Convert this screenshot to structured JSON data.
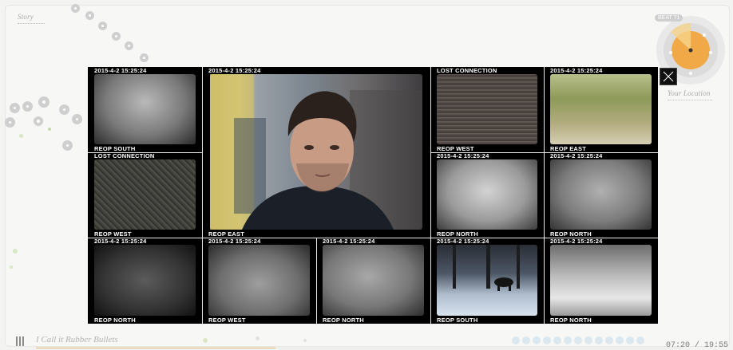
{
  "nav": {
    "story_label": "Story"
  },
  "compass": {
    "speed_badge": "BEAT 71",
    "location_label": "Your Location"
  },
  "modal": {
    "close_label": "close",
    "cells": [
      {
        "id": "c1",
        "timestamp": "2015-4-2 15:25:24",
        "camera": "REOP SOUTH",
        "feed": "night"
      },
      {
        "id": "c2",
        "timestamp": "2015-4-2 15:25:24",
        "camera": "REOP EAST",
        "feed": "webcam"
      },
      {
        "id": "c3",
        "timestamp": "LOST CONNECTION",
        "camera": "REOP WEST",
        "feed": "static"
      },
      {
        "id": "c4",
        "timestamp": "2015-4-2 15:25:24",
        "camera": "REOP EAST",
        "feed": "forest"
      },
      {
        "id": "c5",
        "timestamp": "LOST CONNECTION",
        "camera": "REOP WEST",
        "feed": "static"
      },
      {
        "id": "c6",
        "timestamp": "2015-4-2 15:25:24",
        "camera": "REOP NORTH",
        "feed": "night"
      },
      {
        "id": "c7",
        "timestamp": "2015-4-2 15:25:24",
        "camera": "REOP NORTH",
        "feed": "night"
      },
      {
        "id": "c8",
        "timestamp": "2015-4-2 15:25:24",
        "camera": "REOP NORTH",
        "feed": "dark"
      },
      {
        "id": "c9",
        "timestamp": "2015-4-2 15:25:24",
        "camera": "REOP WEST",
        "feed": "night"
      },
      {
        "id": "c10",
        "timestamp": "2015-4-2 15:25:24",
        "camera": "REOP NORTH",
        "feed": "night"
      },
      {
        "id": "c11",
        "timestamp": "2015-4-2 15:25:24",
        "camera": "REOP SOUTH",
        "feed": "snow"
      },
      {
        "id": "c12",
        "timestamp": "2015-4-2 15:25:24",
        "camera": "REOP NORTH",
        "feed": "snowgray"
      }
    ]
  },
  "player": {
    "track_title": "I Call it Rubber Bullets",
    "time": "07:20 / 19:55",
    "progress": 0.37,
    "accent_color": "#e0b26b"
  }
}
